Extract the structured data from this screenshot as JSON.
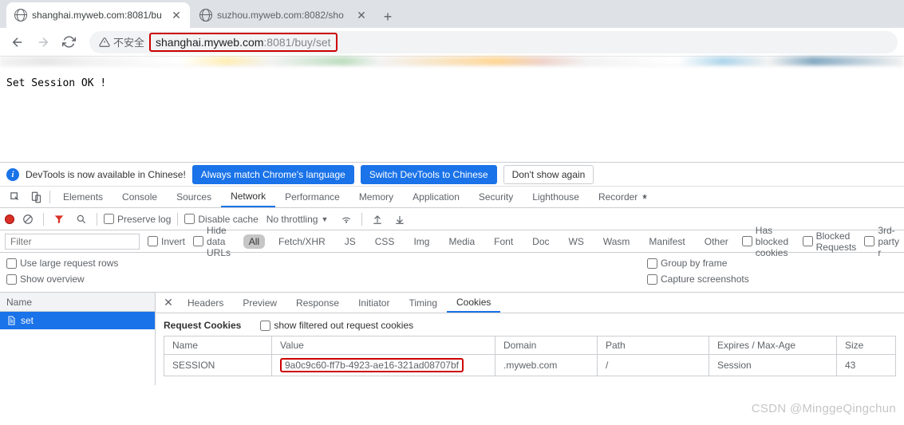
{
  "tabs": [
    {
      "title": "shanghai.myweb.com:8081/bu",
      "active": true
    },
    {
      "title": "suzhou.myweb.com:8082/sho",
      "active": false
    }
  ],
  "toolbar": {
    "insecure_label": "不安全",
    "url_host": "shanghai.myweb.com",
    "url_port": ":8081",
    "url_path": "/buy/set"
  },
  "page_body": "Set Session OK !",
  "devtools": {
    "notice": {
      "text": "DevTools is now available in Chinese!",
      "btn_match": "Always match Chrome's language",
      "btn_switch": "Switch DevTools to Chinese",
      "btn_dismiss": "Don't show again"
    },
    "panel_tabs": [
      "Elements",
      "Console",
      "Sources",
      "Network",
      "Performance",
      "Memory",
      "Application",
      "Security",
      "Lighthouse",
      "Recorder"
    ],
    "panel_active": "Network",
    "network_toolbar": {
      "preserve_log": "Preserve log",
      "disable_cache": "Disable cache",
      "throttling": "No throttling"
    },
    "filter_bar": {
      "placeholder": "Filter",
      "invert": "Invert",
      "hide_data_urls": "Hide data URLs",
      "types": [
        "All",
        "Fetch/XHR",
        "JS",
        "CSS",
        "Img",
        "Media",
        "Font",
        "Doc",
        "WS",
        "Wasm",
        "Manifest",
        "Other"
      ],
      "type_active": "All",
      "has_blocked": "Has blocked cookies",
      "blocked_req": "Blocked Requests",
      "third_party": "3rd-party r"
    },
    "options": {
      "large_rows": "Use large request rows",
      "show_overview": "Show overview",
      "group_frame": "Group by frame",
      "capture_ss": "Capture screenshots"
    },
    "request_list": {
      "header": "Name",
      "items": [
        "set"
      ]
    },
    "detail_tabs": [
      "Headers",
      "Preview",
      "Response",
      "Initiator",
      "Timing",
      "Cookies"
    ],
    "detail_active": "Cookies",
    "cookies": {
      "section_title": "Request Cookies",
      "show_filtered": "show filtered out request cookies",
      "columns": [
        "Name",
        "Value",
        "Domain",
        "Path",
        "Expires / Max-Age",
        "Size"
      ],
      "row": {
        "name": "SESSION",
        "value": "9a0c9c60-ff7b-4923-ae16-321ad08707bf",
        "domain": ".myweb.com",
        "path": "/",
        "expires": "Session",
        "size": "43"
      }
    }
  },
  "watermark": "CSDN @MinggeQingchun"
}
